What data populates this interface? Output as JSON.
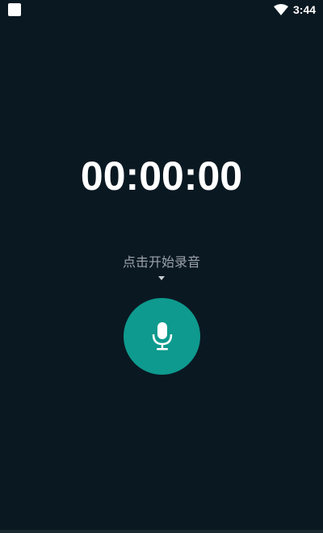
{
  "status_bar": {
    "time": "3:44",
    "icons": [
      "app-square-icon",
      "wifi-icon"
    ]
  },
  "timer": {
    "value": "00:00:00"
  },
  "hint": {
    "text": "点击开始录音",
    "arrow_icon": "caret-down-icon"
  },
  "record_button": {
    "icon": "microphone-icon",
    "color": "#0e9a8e"
  },
  "colors": {
    "background": "#0a1822",
    "accent": "#0e9a8e",
    "hint": "#9aa3ab"
  }
}
